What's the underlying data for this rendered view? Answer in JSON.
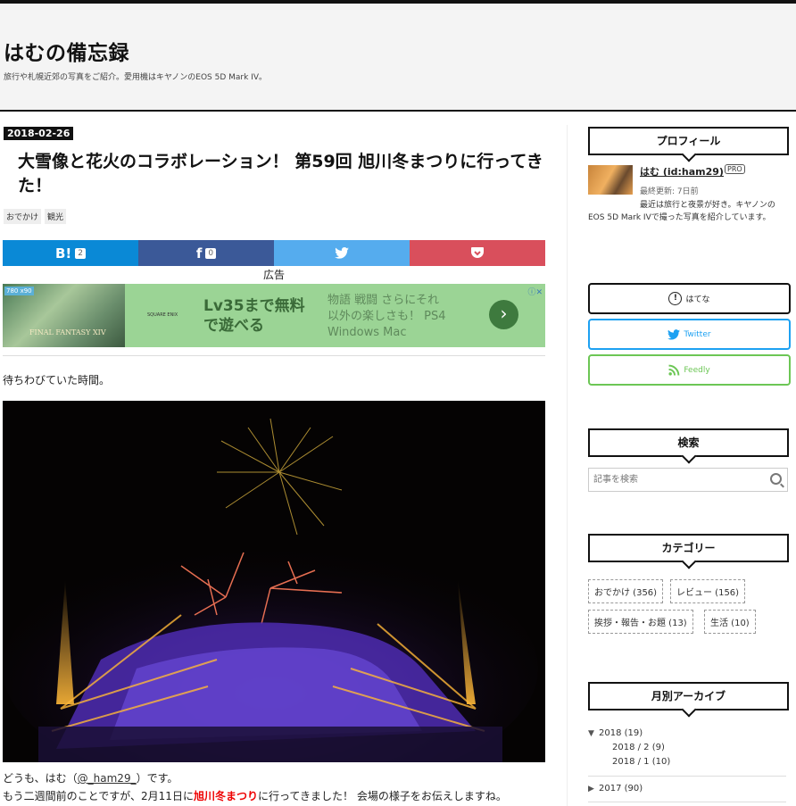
{
  "header": {
    "blog_title": "はむの備忘録",
    "description": "旅行や札幌近郊の写真をご紹介。愛用機はキヤノンのEOS 5D Mark IV。"
  },
  "entry": {
    "date": "2018-02-26",
    "title": "大雪像と花火のコラボレーション！ 第59回 旭川冬まつりに行ってきた！",
    "tags": [
      "おでかけ",
      "観光"
    ],
    "share": {
      "hatena_label": "B!",
      "hatena_count": "2",
      "facebook_label": "f",
      "facebook_count": "0",
      "twitter_label": "🐦",
      "pocket_label": "⌄"
    },
    "ad_label": "広告",
    "ad": {
      "badge": "780\nx90",
      "game_logo": "FINAL FANTASY XIV",
      "maker": "SQUARE ENIX",
      "main_copy": "Lv35まで無料\nで遊べる",
      "sub_copy": "物語 戦闘 さらにそれ\n以外の楽しさも！ PS4\nWindows Mac",
      "arrow": "›",
      "close": "ⓘ✕"
    },
    "intro": "待ちわびていた時間。",
    "paragraph1_pre": "どうも、はむ（",
    "paragraph1_link": "@_ham29_",
    "paragraph1_post": "）です。",
    "paragraph2_pre": "もう二週間前のことですが、2月11日に",
    "paragraph2_highlight": "旭川冬まつり",
    "paragraph2_post": "に行ってきました！ 会場の様子をお伝えしますね。"
  },
  "sidebar": {
    "profile": {
      "title": "プロフィール",
      "username": "はむ (id:ham29)",
      "badge": "PRO",
      "updated": "最終更新: 7日前",
      "bio": "最近は旅行と夜景が好き。キヤノンのEOS 5D Mark IVで撮った写真を紹介しています。"
    },
    "follow": {
      "hatena": "はてな",
      "twitter": "Twitter",
      "feedly": "Feedly"
    },
    "search": {
      "title": "検索",
      "placeholder": "記事を検索"
    },
    "categories": {
      "title": "カテゴリー",
      "items": [
        "おでかけ (356)",
        "レビュー (156)",
        "挨拶・報告・お題 (13)",
        "生活 (10)"
      ]
    },
    "archive": {
      "title": "月別アーカイブ",
      "year1": "2018 (19)",
      "month1": "2018 / 2 (9)",
      "month2": "2018 / 1 (10)",
      "year2": "2017 (90)"
    }
  },
  "colors": {
    "hatena": "#0a89d6",
    "facebook": "#3b5998",
    "twitter": "#55acee",
    "pocket": "#d94f5c",
    "highlight": "#ee0000",
    "ad_bg": "#9bd495"
  }
}
